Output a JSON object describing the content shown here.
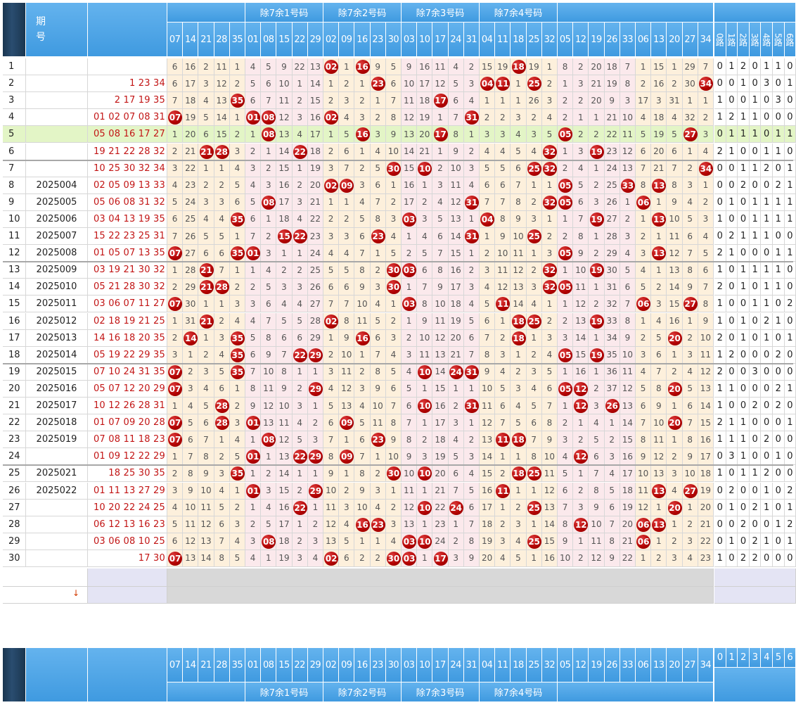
{
  "header": {
    "period_label": "期\n号",
    "group_labels": [
      "除7余1号码",
      "除7余2号码",
      "除7余3号码",
      "除7余4号码"
    ],
    "number_columns": [
      "07",
      "14",
      "21",
      "28",
      "35",
      "01",
      "08",
      "15",
      "22",
      "29",
      "02",
      "09",
      "16",
      "23",
      "30",
      "03",
      "10",
      "17",
      "24",
      "31",
      "04",
      "11",
      "18",
      "25",
      "32",
      "05",
      "12",
      "19",
      "26",
      "33",
      "06",
      "13",
      "20",
      "27",
      "34"
    ],
    "road_columns": [
      "0路",
      "1路",
      "2路",
      "3路",
      "4路",
      "5路",
      "6路"
    ],
    "road_digits": [
      "0",
      "1",
      "2",
      "3",
      "4",
      "5",
      "6"
    ]
  },
  "rows": [
    {
      "idx": "1",
      "issue": "",
      "draw": "",
      "vals": [
        6,
        16,
        2,
        11,
        1,
        4,
        5,
        9,
        22,
        13,
        "02",
        1,
        "16",
        9,
        5,
        9,
        16,
        11,
        4,
        2,
        15,
        19,
        "18",
        19,
        1,
        8,
        2,
        20,
        18,
        7,
        1,
        15,
        1,
        29,
        7
      ],
      "roads": [
        0,
        1,
        2,
        0,
        1,
        1,
        0
      ]
    },
    {
      "idx": "2",
      "issue": "",
      "draw": "1 23 34",
      "vals": [
        6,
        17,
        3,
        12,
        2,
        5,
        6,
        10,
        1,
        14,
        1,
        2,
        1,
        "23",
        6,
        10,
        17,
        12,
        5,
        3,
        "04",
        "11",
        1,
        "25",
        2,
        1,
        3,
        21,
        19,
        8,
        2,
        16,
        2,
        30,
        "34"
      ],
      "roads": [
        0,
        0,
        1,
        0,
        3,
        0,
        1
      ]
    },
    {
      "idx": "3",
      "issue": "",
      "draw": "2 17 19 35",
      "vals": [
        7,
        18,
        4,
        13,
        "35",
        6,
        7,
        11,
        2,
        15,
        2,
        3,
        2,
        1,
        7,
        11,
        18,
        "17",
        6,
        4,
        1,
        1,
        1,
        26,
        3,
        2,
        2,
        20,
        9,
        3,
        17,
        3,
        31,
        1,
        1
      ],
      "roads": [
        1,
        0,
        0,
        1,
        0,
        3,
        0
      ]
    },
    {
      "idx": "4",
      "issue": "",
      "draw": "01 02 07 08 31",
      "vals": [
        "07",
        19,
        5,
        14,
        1,
        "01",
        "08",
        12,
        3,
        16,
        "02",
        4,
        3,
        2,
        8,
        12,
        19,
        1,
        7,
        "31",
        2,
        2,
        3,
        2,
        4,
        2,
        1,
        1,
        21,
        10,
        4,
        18,
        4,
        32,
        2
      ],
      "roads": [
        1,
        2,
        1,
        1,
        0,
        0,
        0
      ]
    },
    {
      "idx": "5",
      "issue": "",
      "draw": "05 08 16 17 27",
      "vals": [
        1,
        20,
        6,
        15,
        2,
        1,
        "08",
        13,
        4,
        17,
        1,
        5,
        "16",
        3,
        9,
        13,
        20,
        "17",
        8,
        1,
        3,
        3,
        4,
        3,
        5,
        "05",
        2,
        2,
        22,
        11,
        5,
        19,
        5,
        "27",
        3
      ],
      "roads": [
        0,
        1,
        1,
        1,
        0,
        1,
        1
      ]
    },
    {
      "idx": "6",
      "issue": "",
      "draw": "19 21 22 28 32",
      "vals": [
        2,
        21,
        "21",
        "28",
        3,
        2,
        1,
        14,
        "22",
        18,
        2,
        6,
        1,
        4,
        10,
        14,
        21,
        1,
        9,
        2,
        4,
        4,
        5,
        4,
        "32",
        1,
        3,
        "19",
        23,
        12,
        6,
        20,
        6,
        1,
        4
      ],
      "roads": [
        2,
        1,
        0,
        0,
        1,
        1,
        0
      ]
    },
    {
      "idx": "7",
      "issue": "",
      "draw": "10 25 30 32 34",
      "vals": [
        3,
        22,
        1,
        1,
        4,
        3,
        2,
        15,
        1,
        19,
        3,
        7,
        2,
        5,
        "30",
        15,
        "10",
        2,
        10,
        3,
        5,
        5,
        6,
        "25",
        "32",
        2,
        4,
        1,
        24,
        13,
        7,
        21,
        7,
        2,
        "34"
      ],
      "roads": [
        0,
        0,
        1,
        1,
        2,
        0,
        1
      ]
    },
    {
      "idx": "8",
      "issue": "2025004",
      "draw": "02 05 09 13 33",
      "vals": [
        4,
        23,
        2,
        2,
        5,
        4,
        3,
        16,
        2,
        20,
        "02",
        "09",
        3,
        6,
        1,
        16,
        1,
        3,
        11,
        4,
        6,
        6,
        7,
        1,
        1,
        "05",
        5,
        2,
        25,
        "33",
        8,
        "13",
        8,
        3,
        1
      ],
      "roads": [
        0,
        0,
        2,
        0,
        0,
        2,
        1
      ]
    },
    {
      "idx": "9",
      "issue": "2025005",
      "draw": "05 06 08 31 32",
      "vals": [
        5,
        24,
        3,
        3,
        6,
        5,
        "08",
        17,
        3,
        21,
        1,
        1,
        4,
        7,
        2,
        17,
        2,
        4,
        12,
        "31",
        7,
        7,
        8,
        2,
        "32",
        "05",
        6,
        3,
        26,
        1,
        "06",
        1,
        9,
        4,
        2
      ],
      "roads": [
        0,
        1,
        0,
        1,
        1,
        1,
        1
      ]
    },
    {
      "idx": "10",
      "issue": "2025006",
      "draw": "03 04 13 19 35",
      "vals": [
        6,
        25,
        4,
        4,
        "35",
        6,
        1,
        18,
        4,
        22,
        2,
        2,
        5,
        8,
        3,
        "03",
        3,
        5,
        13,
        1,
        "04",
        8,
        9,
        3,
        1,
        1,
        7,
        "19",
        27,
        2,
        1,
        "13",
        10,
        5,
        3
      ],
      "roads": [
        1,
        0,
        0,
        1,
        1,
        1,
        1
      ]
    },
    {
      "idx": "11",
      "issue": "2025007",
      "draw": "15 22 23 25 31",
      "vals": [
        7,
        26,
        5,
        5,
        1,
        7,
        2,
        "15",
        "22",
        23,
        3,
        3,
        6,
        "23",
        4,
        1,
        4,
        6,
        14,
        "31",
        1,
        9,
        10,
        "25",
        2,
        2,
        8,
        1,
        28,
        3,
        2,
        1,
        11,
        6,
        4
      ],
      "roads": [
        0,
        2,
        1,
        1,
        1,
        0,
        0
      ]
    },
    {
      "idx": "12",
      "issue": "2025008",
      "draw": "01 05 07 13 35",
      "vals": [
        "07",
        27,
        6,
        6,
        "35",
        "01",
        3,
        1,
        1,
        24,
        4,
        4,
        7,
        1,
        5,
        2,
        5,
        7,
        15,
        1,
        2,
        10,
        11,
        1,
        3,
        "05",
        9,
        2,
        29,
        4,
        3,
        "13",
        12,
        7,
        5
      ],
      "roads": [
        2,
        1,
        0,
        0,
        0,
        1,
        1
      ]
    },
    {
      "idx": "13",
      "issue": "2025009",
      "draw": "03 19 21 30 32",
      "vals": [
        1,
        28,
        "21",
        7,
        1,
        1,
        4,
        2,
        2,
        25,
        5,
        5,
        8,
        2,
        "30",
        "03",
        6,
        8,
        16,
        2,
        3,
        11,
        12,
        2,
        "32",
        1,
        10,
        "19",
        30,
        5,
        4,
        1,
        13,
        8,
        6
      ],
      "roads": [
        1,
        0,
        1,
        1,
        1,
        1,
        0
      ]
    },
    {
      "idx": "14",
      "issue": "2025010",
      "draw": "05 21 28 30 32",
      "vals": [
        2,
        29,
        "21",
        "28",
        2,
        2,
        5,
        3,
        3,
        26,
        6,
        6,
        9,
        3,
        "30",
        1,
        7,
        9,
        17,
        3,
        4,
        12,
        13,
        3,
        "32",
        "05",
        11,
        1,
        31,
        6,
        5,
        2,
        14,
        9,
        7
      ],
      "roads": [
        2,
        0,
        1,
        0,
        1,
        1,
        0
      ]
    },
    {
      "idx": "15",
      "issue": "2025011",
      "draw": "03 06 07 11 27",
      "vals": [
        "07",
        30,
        1,
        1,
        3,
        3,
        6,
        4,
        4,
        27,
        7,
        7,
        10,
        4,
        1,
        "03",
        8,
        10,
        18,
        4,
        5,
        "11",
        14,
        4,
        1,
        1,
        12,
        2,
        32,
        7,
        "06",
        3,
        15,
        "27",
        8
      ],
      "roads": [
        1,
        0,
        0,
        1,
        1,
        0,
        2
      ]
    },
    {
      "idx": "16",
      "issue": "2025012",
      "draw": "02 18 19 21 25",
      "vals": [
        1,
        31,
        "21",
        2,
        4,
        4,
        7,
        5,
        5,
        28,
        "02",
        8,
        11,
        5,
        2,
        1,
        9,
        11,
        19,
        5,
        6,
        1,
        "18",
        "25",
        2,
        2,
        13,
        "19",
        33,
        8,
        1,
        4,
        16,
        1,
        9
      ],
      "roads": [
        1,
        0,
        1,
        0,
        2,
        1,
        0
      ]
    },
    {
      "idx": "17",
      "issue": "2025013",
      "draw": "14 16 18 20 35",
      "vals": [
        2,
        "14",
        1,
        3,
        "35",
        5,
        8,
        6,
        6,
        29,
        1,
        9,
        "16",
        6,
        3,
        2,
        10,
        12,
        20,
        6,
        7,
        2,
        "18",
        1,
        3,
        3,
        14,
        1,
        34,
        9,
        2,
        5,
        "20",
        2,
        10
      ],
      "roads": [
        2,
        0,
        1,
        0,
        1,
        0,
        1
      ]
    },
    {
      "idx": "18",
      "issue": "2025014",
      "draw": "05 19 22 29 35",
      "vals": [
        3,
        1,
        2,
        4,
        "35",
        6,
        9,
        7,
        "22",
        "29",
        2,
        10,
        1,
        7,
        4,
        3,
        11,
        13,
        21,
        7,
        8,
        3,
        1,
        2,
        4,
        "05",
        15,
        "19",
        35,
        10,
        3,
        6,
        1,
        3,
        11
      ],
      "roads": [
        1,
        2,
        0,
        0,
        0,
        2,
        0
      ]
    },
    {
      "idx": "19",
      "issue": "2025015",
      "draw": "07 10 24 31 35",
      "vals": [
        "07",
        2,
        3,
        5,
        "35",
        7,
        10,
        8,
        1,
        1,
        3,
        11,
        2,
        8,
        5,
        4,
        "10",
        14,
        "24",
        "31",
        9,
        4,
        2,
        3,
        5,
        1,
        16,
        1,
        36,
        11,
        4,
        7,
        2,
        4,
        12
      ],
      "roads": [
        2,
        0,
        0,
        3,
        0,
        0,
        0
      ]
    },
    {
      "idx": "20",
      "issue": "2025016",
      "draw": "05 07 12 20 29",
      "vals": [
        "07",
        3,
        4,
        6,
        1,
        8,
        11,
        9,
        2,
        "29",
        4,
        12,
        3,
        9,
        6,
        5,
        1,
        15,
        1,
        1,
        10,
        5,
        3,
        4,
        6,
        "05",
        "12",
        2,
        37,
        12,
        5,
        8,
        "20",
        5,
        13
      ],
      "roads": [
        1,
        1,
        0,
        0,
        0,
        2,
        1
      ]
    },
    {
      "idx": "21",
      "issue": "2025017",
      "draw": "10 12 26 28 31",
      "vals": [
        1,
        4,
        5,
        "28",
        2,
        9,
        12,
        10,
        3,
        1,
        5,
        13,
        4,
        10,
        7,
        6,
        "10",
        16,
        2,
        "31",
        11,
        6,
        4,
        5,
        7,
        1,
        "12",
        3,
        "26",
        13,
        6,
        9,
        1,
        6,
        14
      ],
      "roads": [
        1,
        0,
        0,
        2,
        0,
        2,
        0
      ]
    },
    {
      "idx": "22",
      "issue": "2025018",
      "draw": "01 07 09 20 28",
      "vals": [
        "07",
        5,
        6,
        "28",
        3,
        "01",
        13,
        11,
        4,
        2,
        6,
        "09",
        5,
        11,
        8,
        7,
        1,
        17,
        3,
        1,
        12,
        7,
        5,
        6,
        8,
        2,
        1,
        4,
        1,
        14,
        7,
        10,
        "20",
        7,
        15
      ],
      "roads": [
        2,
        1,
        1,
        0,
        0,
        0,
        1
      ]
    },
    {
      "idx": "23",
      "issue": "2025019",
      "draw": "07 08 11 18 23",
      "vals": [
        "07",
        6,
        7,
        1,
        4,
        1,
        "08",
        12,
        5,
        3,
        7,
        1,
        6,
        "23",
        9,
        8,
        2,
        18,
        4,
        2,
        13,
        "11",
        "18",
        7,
        9,
        3,
        2,
        5,
        2,
        15,
        8,
        11,
        1,
        8,
        16
      ],
      "roads": [
        1,
        1,
        1,
        0,
        2,
        0,
        0
      ]
    },
    {
      "idx": "24",
      "issue": "",
      "draw": "01 09 12 22 29",
      "vals": [
        1,
        7,
        8,
        2,
        5,
        "01",
        1,
        13,
        "22",
        "29",
        8,
        "09",
        7,
        1,
        10,
        9,
        3,
        19,
        5,
        3,
        14,
        1,
        1,
        8,
        10,
        4,
        "12",
        6,
        3,
        16,
        9,
        12,
        2,
        9,
        17
      ],
      "roads": [
        0,
        3,
        1,
        0,
        0,
        1,
        0
      ]
    },
    {
      "idx": "25",
      "issue": "2025021",
      "draw": "18 25 30 35",
      "vals": [
        2,
        8,
        9,
        3,
        "35",
        1,
        2,
        14,
        1,
        1,
        9,
        1,
        8,
        2,
        "30",
        10,
        "10",
        20,
        6,
        4,
        15,
        2,
        "18",
        "25",
        11,
        5,
        1,
        7,
        4,
        17,
        10,
        13,
        3,
        10,
        18
      ],
      "roads": [
        1,
        0,
        1,
        1,
        2,
        0,
        0
      ]
    },
    {
      "idx": "26",
      "issue": "2025022",
      "draw": "01 11 13 27 29",
      "vals": [
        3,
        9,
        10,
        4,
        1,
        "01",
        3,
        15,
        2,
        "29",
        10,
        2,
        9,
        3,
        1,
        11,
        1,
        21,
        7,
        5,
        16,
        "11",
        1,
        1,
        12,
        6,
        2,
        8,
        5,
        18,
        11,
        "13",
        4,
        "27",
        19
      ],
      "roads": [
        0,
        2,
        0,
        0,
        1,
        0,
        2
      ]
    },
    {
      "idx": "27",
      "issue": "",
      "draw": "10 20 22 24 25",
      "vals": [
        4,
        10,
        11,
        5,
        2,
        1,
        4,
        16,
        "22",
        1,
        11,
        3,
        10,
        4,
        2,
        12,
        "10",
        22,
        "24",
        6,
        17,
        1,
        2,
        "25",
        13,
        7,
        3,
        9,
        6,
        19,
        12,
        1,
        "20",
        1,
        20
      ],
      "roads": [
        0,
        1,
        0,
        2,
        1,
        0,
        1
      ]
    },
    {
      "idx": "28",
      "issue": "",
      "draw": "06 12 13 16 23",
      "vals": [
        5,
        11,
        12,
        6,
        3,
        2,
        5,
        17,
        1,
        2,
        12,
        4,
        "16",
        "23",
        3,
        13,
        1,
        23,
        1,
        7,
        18,
        2,
        3,
        1,
        14,
        8,
        "12",
        10,
        7,
        20,
        "06",
        "13",
        1,
        2,
        21
      ],
      "roads": [
        0,
        0,
        2,
        0,
        0,
        1,
        2
      ]
    },
    {
      "idx": "29",
      "issue": "",
      "draw": "03 06 08 10 25",
      "vals": [
        6,
        12,
        13,
        7,
        4,
        3,
        "08",
        18,
        2,
        3,
        13,
        5,
        1,
        1,
        4,
        "03",
        "10",
        24,
        2,
        8,
        19,
        3,
        4,
        "25",
        15,
        9,
        1,
        11,
        8,
        21,
        "06",
        1,
        2,
        3,
        22
      ],
      "roads": [
        0,
        1,
        0,
        2,
        1,
        0,
        1
      ]
    },
    {
      "idx": "30",
      "issue": "",
      "draw": "17 30",
      "vals": [
        "07",
        13,
        14,
        8,
        5,
        4,
        1,
        19,
        3,
        4,
        "02",
        6,
        2,
        2,
        "30",
        "03",
        1,
        "17",
        3,
        9,
        20,
        4,
        5,
        1,
        16,
        10,
        2,
        12,
        9,
        22,
        1,
        2,
        3,
        4,
        23
      ],
      "roads": [
        1,
        0,
        2,
        2,
        0,
        0,
        0
      ]
    }
  ]
}
